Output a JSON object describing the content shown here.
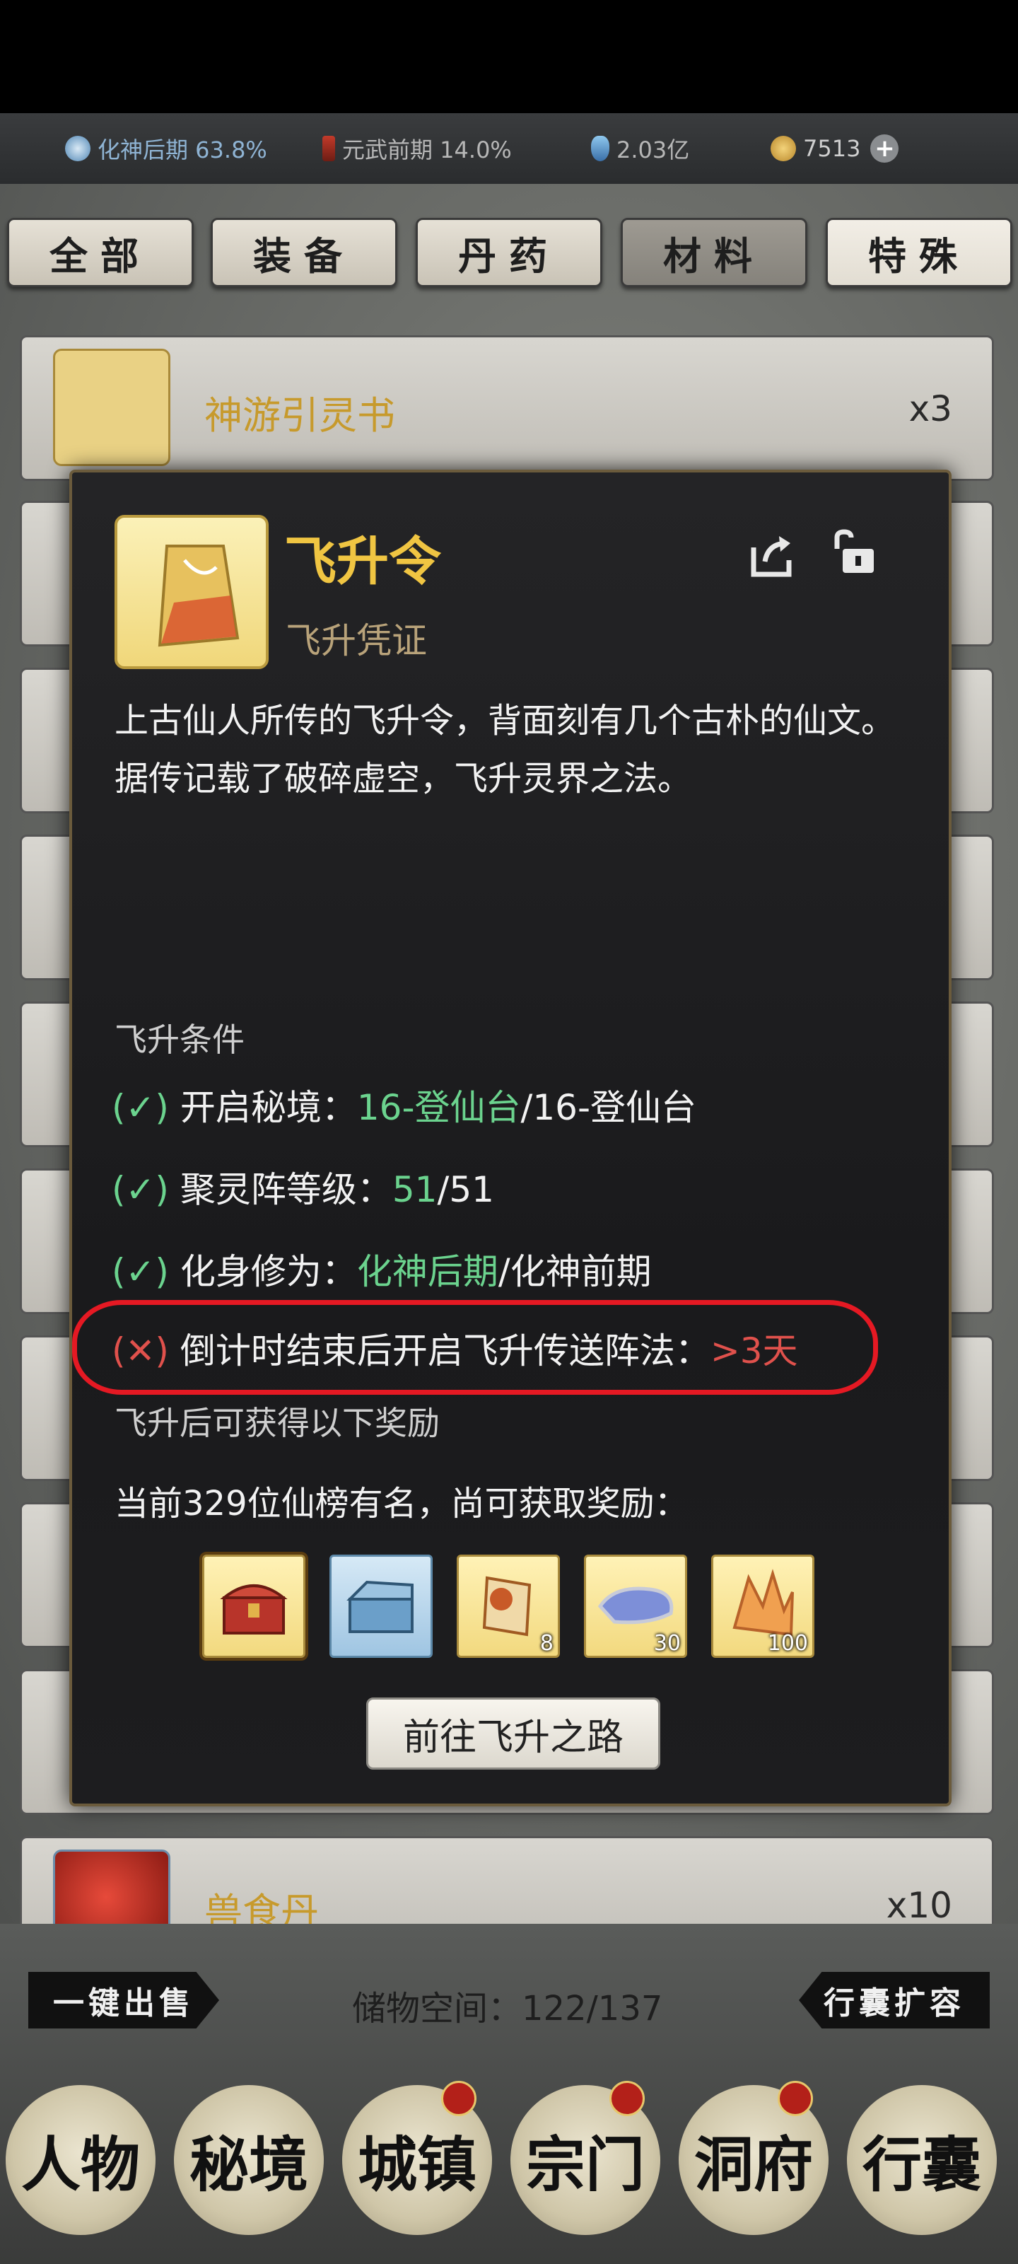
{
  "status": {
    "realm1": {
      "icon": "realm-orb-icon",
      "text": "化神后期 63.8%"
    },
    "realm2": {
      "icon": "realm-sword-icon",
      "text": "元武前期 14.0%"
    },
    "spirit_stone": {
      "icon": "spirit-crystal-icon",
      "text": "2.03亿"
    },
    "coins": {
      "icon": "coin-icon",
      "text": "7513"
    },
    "add_icon": "plus-icon"
  },
  "tabs": [
    "全部",
    "装备",
    "丹药",
    "材料",
    "特殊"
  ],
  "list": [
    {
      "name": "神游引灵书",
      "count": "x3"
    },
    {
      "name": "",
      "count": ""
    },
    {
      "name": "",
      "count": ""
    },
    {
      "name": "",
      "count": ""
    },
    {
      "name": "",
      "count": ""
    },
    {
      "name": "",
      "count": ""
    },
    {
      "name": "",
      "count": ""
    },
    {
      "name": "",
      "count": ""
    },
    {
      "name": "",
      "count": ""
    },
    {
      "name": "兽食丹",
      "count": "x10"
    }
  ],
  "dialog": {
    "title": "飞升令",
    "subtitle": "飞升凭证",
    "desc": "上古仙人所传的飞升令，背面刻有几个古朴的仙文。据传记载了破碎虚空，飞升灵界之法。",
    "cond_title": "飞升条件",
    "conditions": [
      {
        "mark": "(✓)",
        "label": "开启秘境：",
        "current": "16-登仙台",
        "sep": "/",
        "target": "16-登仙台"
      },
      {
        "mark": "(✓)",
        "label": "聚灵阵等级：",
        "current": "51",
        "sep": "/",
        "target": "51"
      },
      {
        "mark": "(✓)",
        "label": "化身修为：",
        "current": "化神后期",
        "sep": "/",
        "target": "化神前期"
      },
      {
        "mark": "(✕)",
        "label": "倒计时结束后开启飞升传送阵法：",
        "current": ">3天",
        "sep": "",
        "target": ""
      }
    ],
    "rewards_title": "飞升后可获得以下奖励",
    "rewards_text": "当前329位仙榜有名，尚可获取奖励：",
    "rewards": [
      {
        "icon": "treasure-chest-icon",
        "qty": ""
      },
      {
        "icon": "blue-chest-icon",
        "qty": ""
      },
      {
        "icon": "scroll-icon",
        "qty": "8"
      },
      {
        "icon": "ore-icon",
        "qty": "30"
      },
      {
        "icon": "crystal-icon",
        "qty": "100"
      }
    ],
    "goto_label": "前往飞升之路"
  },
  "bottom": {
    "sell_all": "一键出售",
    "storage": "储物空间：122/137",
    "expand": "行囊扩容"
  },
  "nav": [
    "人物",
    "秘境",
    "城镇",
    "宗门",
    "洞府",
    "行囊"
  ]
}
